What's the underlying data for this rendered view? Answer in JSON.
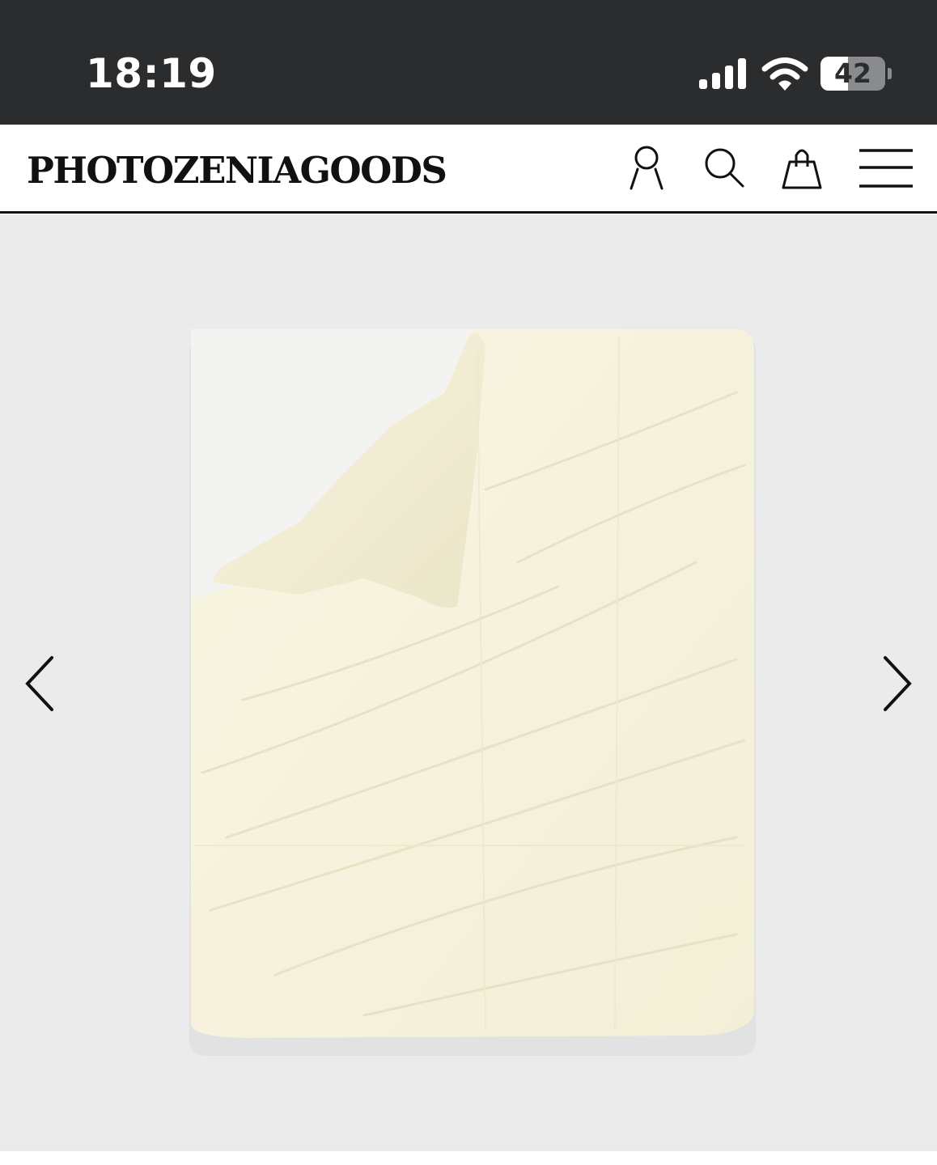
{
  "status_bar": {
    "time": "18:19",
    "battery_level": "42",
    "battery_fraction": 0.42,
    "icons": [
      "signal-icon",
      "wifi-icon",
      "battery-icon"
    ]
  },
  "header": {
    "logo": "PHOTOZENIAGOODS",
    "icons": [
      "account-icon",
      "search-icon",
      "shopping-bag-icon",
      "menu-icon"
    ]
  },
  "gallery": {
    "image_subject": "product-image",
    "navigation": [
      "previous-arrow-icon",
      "next-arrow-icon"
    ]
  },
  "colors": {
    "status_bar": "#2b2c2e",
    "gallery_background": "#ebebec",
    "text": "#111111"
  }
}
